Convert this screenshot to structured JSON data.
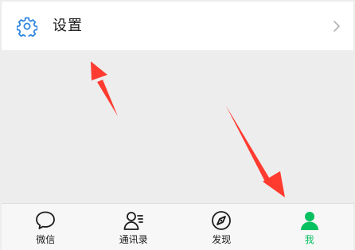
{
  "settings_row": {
    "label": "设置",
    "icon": "gear-icon",
    "chevron": "chevron-right-icon"
  },
  "tabbar": {
    "active_color": "#07c160",
    "tabs": [
      {
        "label": "微信",
        "icon": "chat-bubble-icon",
        "active": false
      },
      {
        "label": "通讯录",
        "icon": "contacts-icon",
        "active": false
      },
      {
        "label": "发现",
        "icon": "compass-icon",
        "active": false
      },
      {
        "label": "我",
        "icon": "person-icon",
        "active": true
      }
    ]
  },
  "annotations": {
    "arrow_color": "#ff3b30"
  }
}
